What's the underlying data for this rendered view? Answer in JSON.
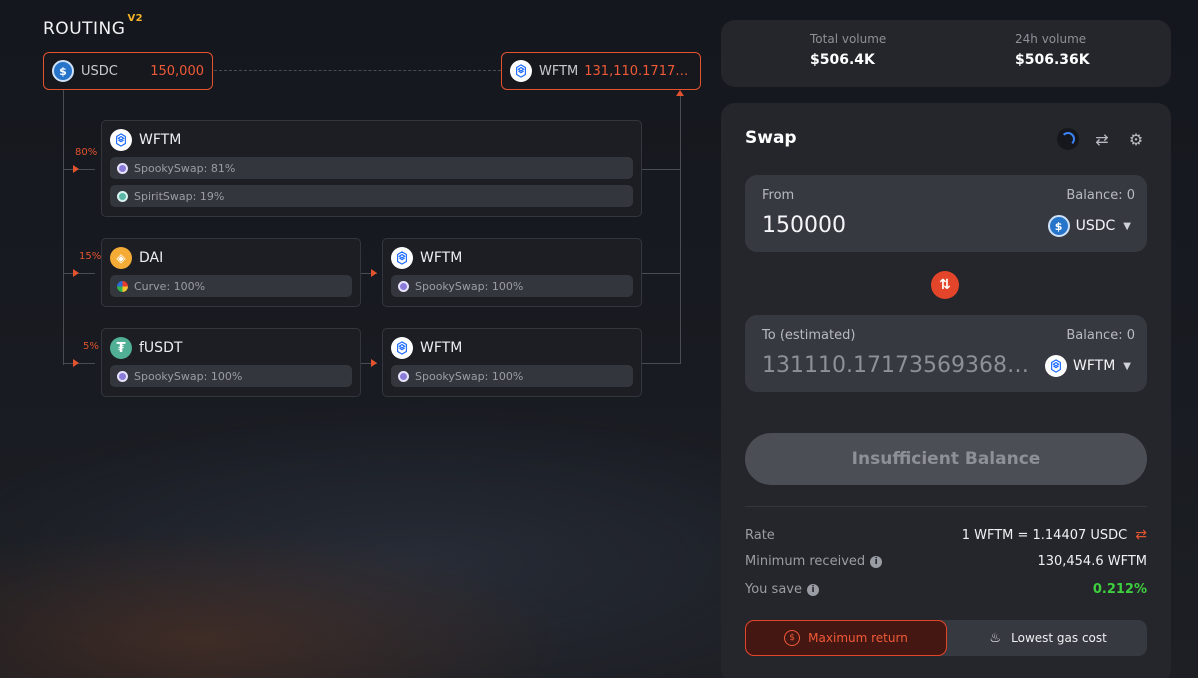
{
  "routing": {
    "title": "ROUTING",
    "version": "V2",
    "source": {
      "symbol": "USDC",
      "amount": "150,000",
      "icon": "usdc-icon"
    },
    "destination": {
      "symbol": "WFTM",
      "amount": "131,110.17173569...",
      "icon": "wftm-icon"
    },
    "routes": [
      {
        "percent": "80%",
        "hops": [
          {
            "symbol": "WFTM",
            "pools": [
              "SpookySwap: 81%",
              "SpiritSwap: 19%"
            ]
          }
        ]
      },
      {
        "percent": "15%",
        "hops": [
          {
            "symbol": "DAI",
            "pools": [
              "Curve: 100%"
            ]
          },
          {
            "symbol": "WFTM",
            "pools": [
              "SpookySwap: 100%"
            ]
          }
        ]
      },
      {
        "percent": "5%",
        "hops": [
          {
            "symbol": "fUSDT",
            "pools": [
              "SpookySwap: 100%"
            ]
          },
          {
            "symbol": "WFTM",
            "pools": [
              "SpookySwap: 100%"
            ]
          }
        ]
      }
    ]
  },
  "stats": {
    "total_volume_label": "Total volume",
    "total_volume_value": "$506.4K",
    "volume_24h_label": "24h volume",
    "volume_24h_value": "$506.36K"
  },
  "swap": {
    "title": "Swap",
    "from": {
      "label": "From",
      "balance": "Balance: 0",
      "value": "150000",
      "token": "USDC"
    },
    "to": {
      "label": "To (estimated)",
      "balance": "Balance: 0",
      "value": "131110.17173569368172877",
      "token": "WFTM"
    },
    "action_button": "Insufficient Balance",
    "rate_label": "Rate",
    "rate_value": "1 WFTM = 1.14407 USDC",
    "min_received_label": "Minimum received",
    "min_received_value": "130,454.6 WFTM",
    "you_save_label": "You save",
    "you_save_value": "0.212%",
    "mode_max_return": "Maximum return",
    "mode_lowest_gas": "Lowest gas cost"
  },
  "colors": {
    "accent": "#e2532e",
    "positive": "#3ecf3e",
    "panel": "#24262c"
  }
}
